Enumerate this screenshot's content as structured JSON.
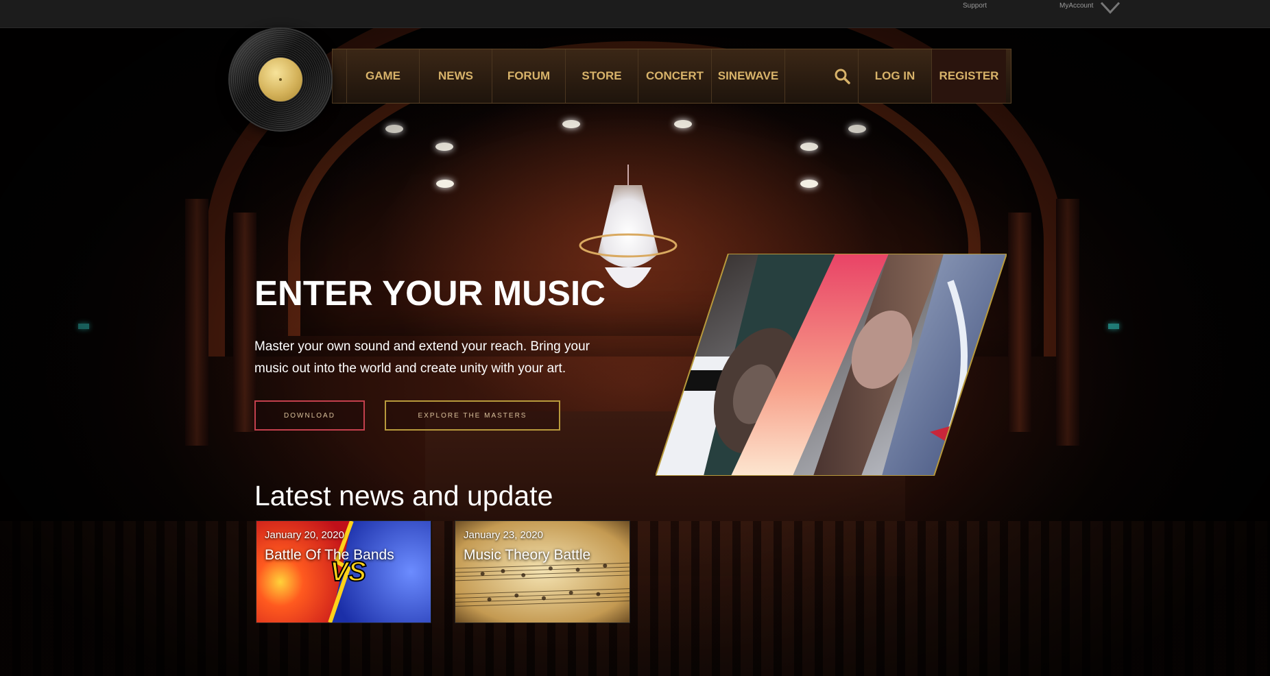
{
  "utility_bar": {
    "support_label": "Support",
    "account_label": "MyAccount"
  },
  "nav": {
    "items": [
      {
        "label": "GAME"
      },
      {
        "label": "NEWS"
      },
      {
        "label": "FORUM"
      },
      {
        "label": "STORE"
      },
      {
        "label": "CONCERT"
      },
      {
        "label": "SINEWAVE"
      }
    ],
    "search_icon": "search-icon",
    "login_label": "LOG IN",
    "register_label": "REGISTER"
  },
  "hero": {
    "title": "ENTER YOUR MUSIC",
    "text": "Master your own sound and extend your reach. Bring your music out into the world and create unity with your art.",
    "download_label": "DOWNLOAD",
    "explore_label": "EXPLORE THE MASTERS"
  },
  "news": {
    "heading": "Latest news and update",
    "cards": [
      {
        "date": "January 20, 2020",
        "title": "Battle Of The Bands"
      },
      {
        "date": "January 23, 2020",
        "title": "Music Theory Battle"
      }
    ]
  },
  "colors": {
    "nav_text": "#d8b36a",
    "download_border": "#c4404d",
    "explore_border": "#b89a3c",
    "nav_bg": "#3b2716"
  }
}
